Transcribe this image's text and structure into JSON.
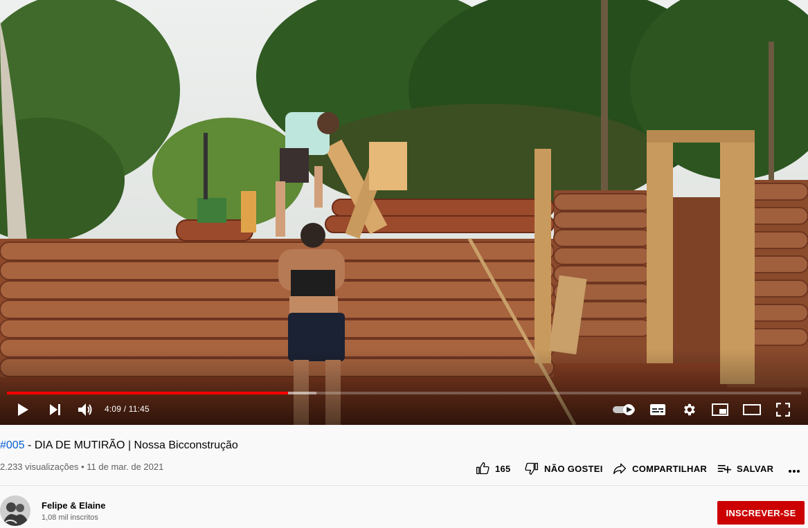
{
  "player": {
    "current_time": "4:09",
    "duration": "11:45",
    "time_separator": " / ",
    "progress_played": 0.354,
    "progress_buffered": 0.39
  },
  "video": {
    "hashtag": "#005",
    "title_rest": " - DIA DE MUTIRÃO | Nossa Bicconstrução",
    "views": "2.233 visualizações",
    "date": "11 de mar. de 2021"
  },
  "actions": {
    "like_count": "165",
    "dislike_label": "NÃO GOSTEI",
    "share_label": "COMPARTILHAR",
    "save_label": "SALVAR"
  },
  "channel": {
    "name": "Felipe & Elaine",
    "subscribers": "1,08 mil inscritos",
    "subscribe_label": "INSCREVER-SE"
  },
  "colors": {
    "accent_red": "#cc0000",
    "progress_red": "#ff0000",
    "link_blue": "#065fd4"
  }
}
